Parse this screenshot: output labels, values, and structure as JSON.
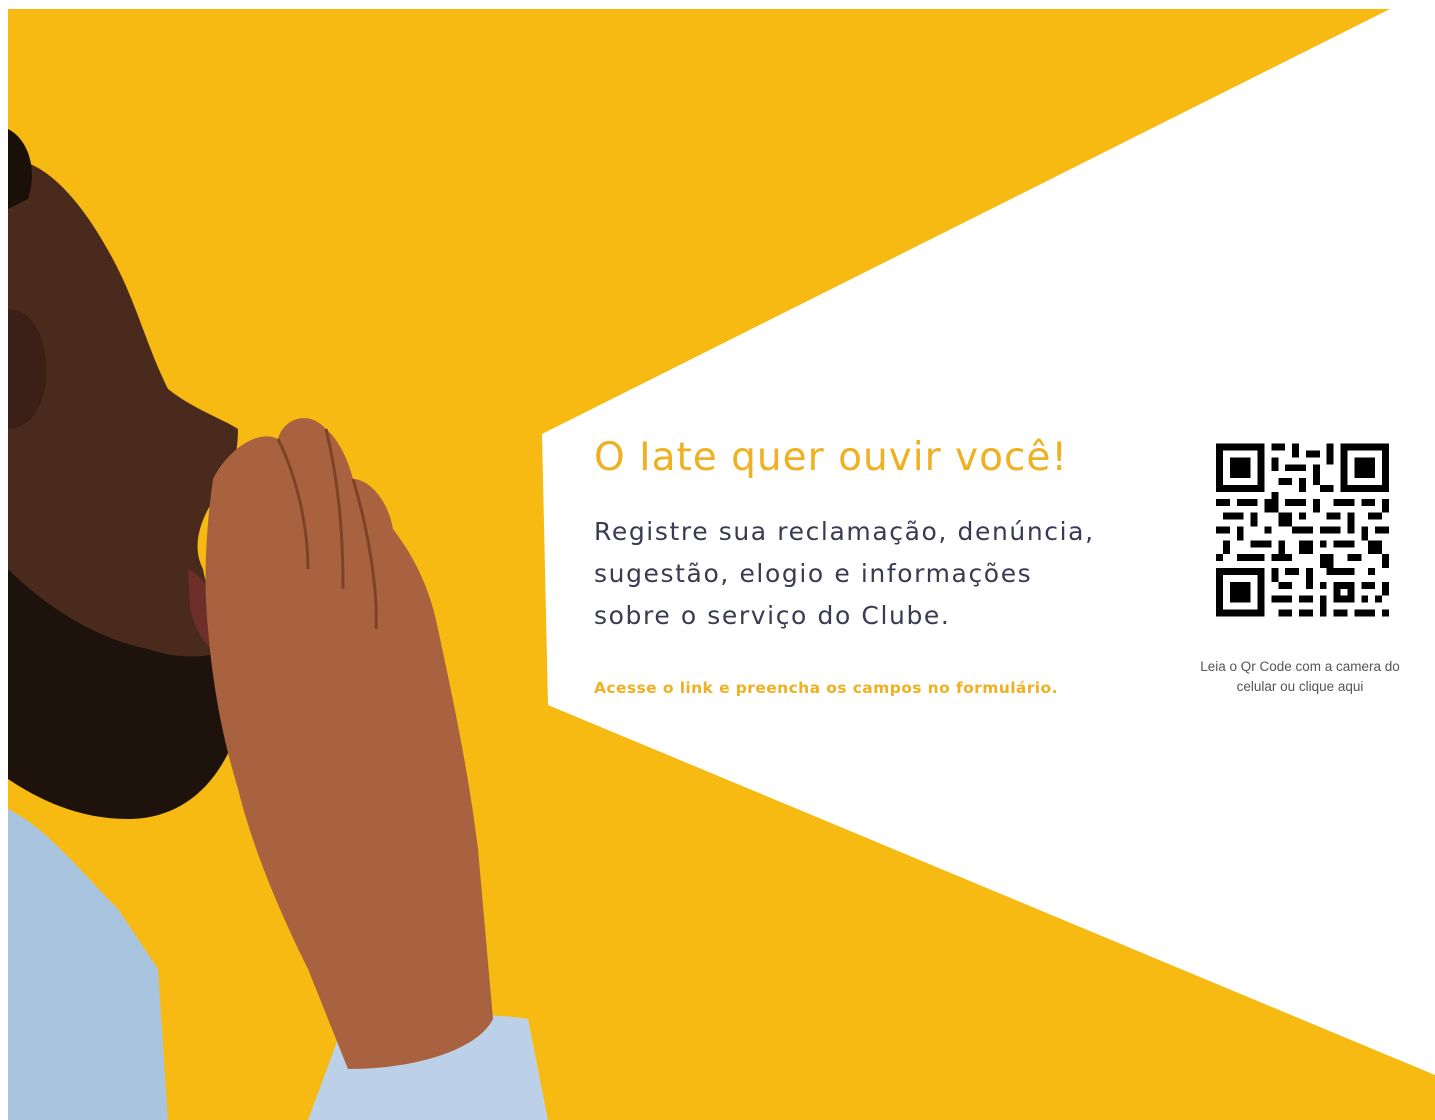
{
  "banner": {
    "headline": "O Iate quer ouvir você!",
    "message_lines": [
      "Registre sua reclamação, denúncia,",
      "sugestão, elogio e informações",
      "sobre o serviço do Clube."
    ],
    "cta": "Acesse o link e preencha os campos no formulário.",
    "image": "man-shouting-photo"
  },
  "qr_card": {
    "icon": "qr-code-icon",
    "caption_lines": [
      "Leia o Qr Code com a camera do",
      "celular ou clique aqui"
    ]
  },
  "colors": {
    "background": "#F6BA12",
    "beam": "#ffffff",
    "headline": "#EFB021",
    "body_text": "#3A3A52",
    "cta": "#EFB021",
    "caption": "#555555"
  }
}
